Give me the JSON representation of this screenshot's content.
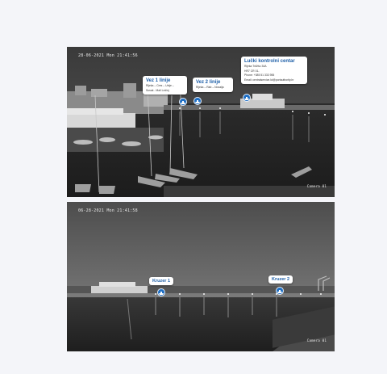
{
  "camera1": {
    "timestamp": "28-06-2021 Mon 21:41:56",
    "label": "Camera 01",
    "markers": [
      {
        "title": "Vez 1 linije",
        "details": [
          "Rijeka – Cres – Unije –",
          "Susak - Mali Lošinj"
        ],
        "icon": "ship-icon"
      },
      {
        "title": "Vez 2 linije",
        "details": [
          "Rijeka – Rab – Novalja"
        ],
        "icon": "ship-icon"
      },
      {
        "title": "Lučki kontrolni centar",
        "details": [
          "Rijeka Trđžšo 34A",
          "HR7 CR 01-",
          "Phone: +385 51 333 955",
          "Email: centralservice.lcl@portauthority.hr"
        ],
        "icon": "ship-icon"
      }
    ]
  },
  "camera2": {
    "timestamp": "06-28-2021 Mon 21:41:58",
    "label": "Camera 01",
    "markers": [
      {
        "title": "Kruzer 1",
        "icon": "ship-icon"
      },
      {
        "title": "Kruzer 2",
        "icon": "ship-icon"
      }
    ]
  },
  "colors": {
    "accent": "#1f6fc4",
    "background": "#f4f5f9"
  }
}
